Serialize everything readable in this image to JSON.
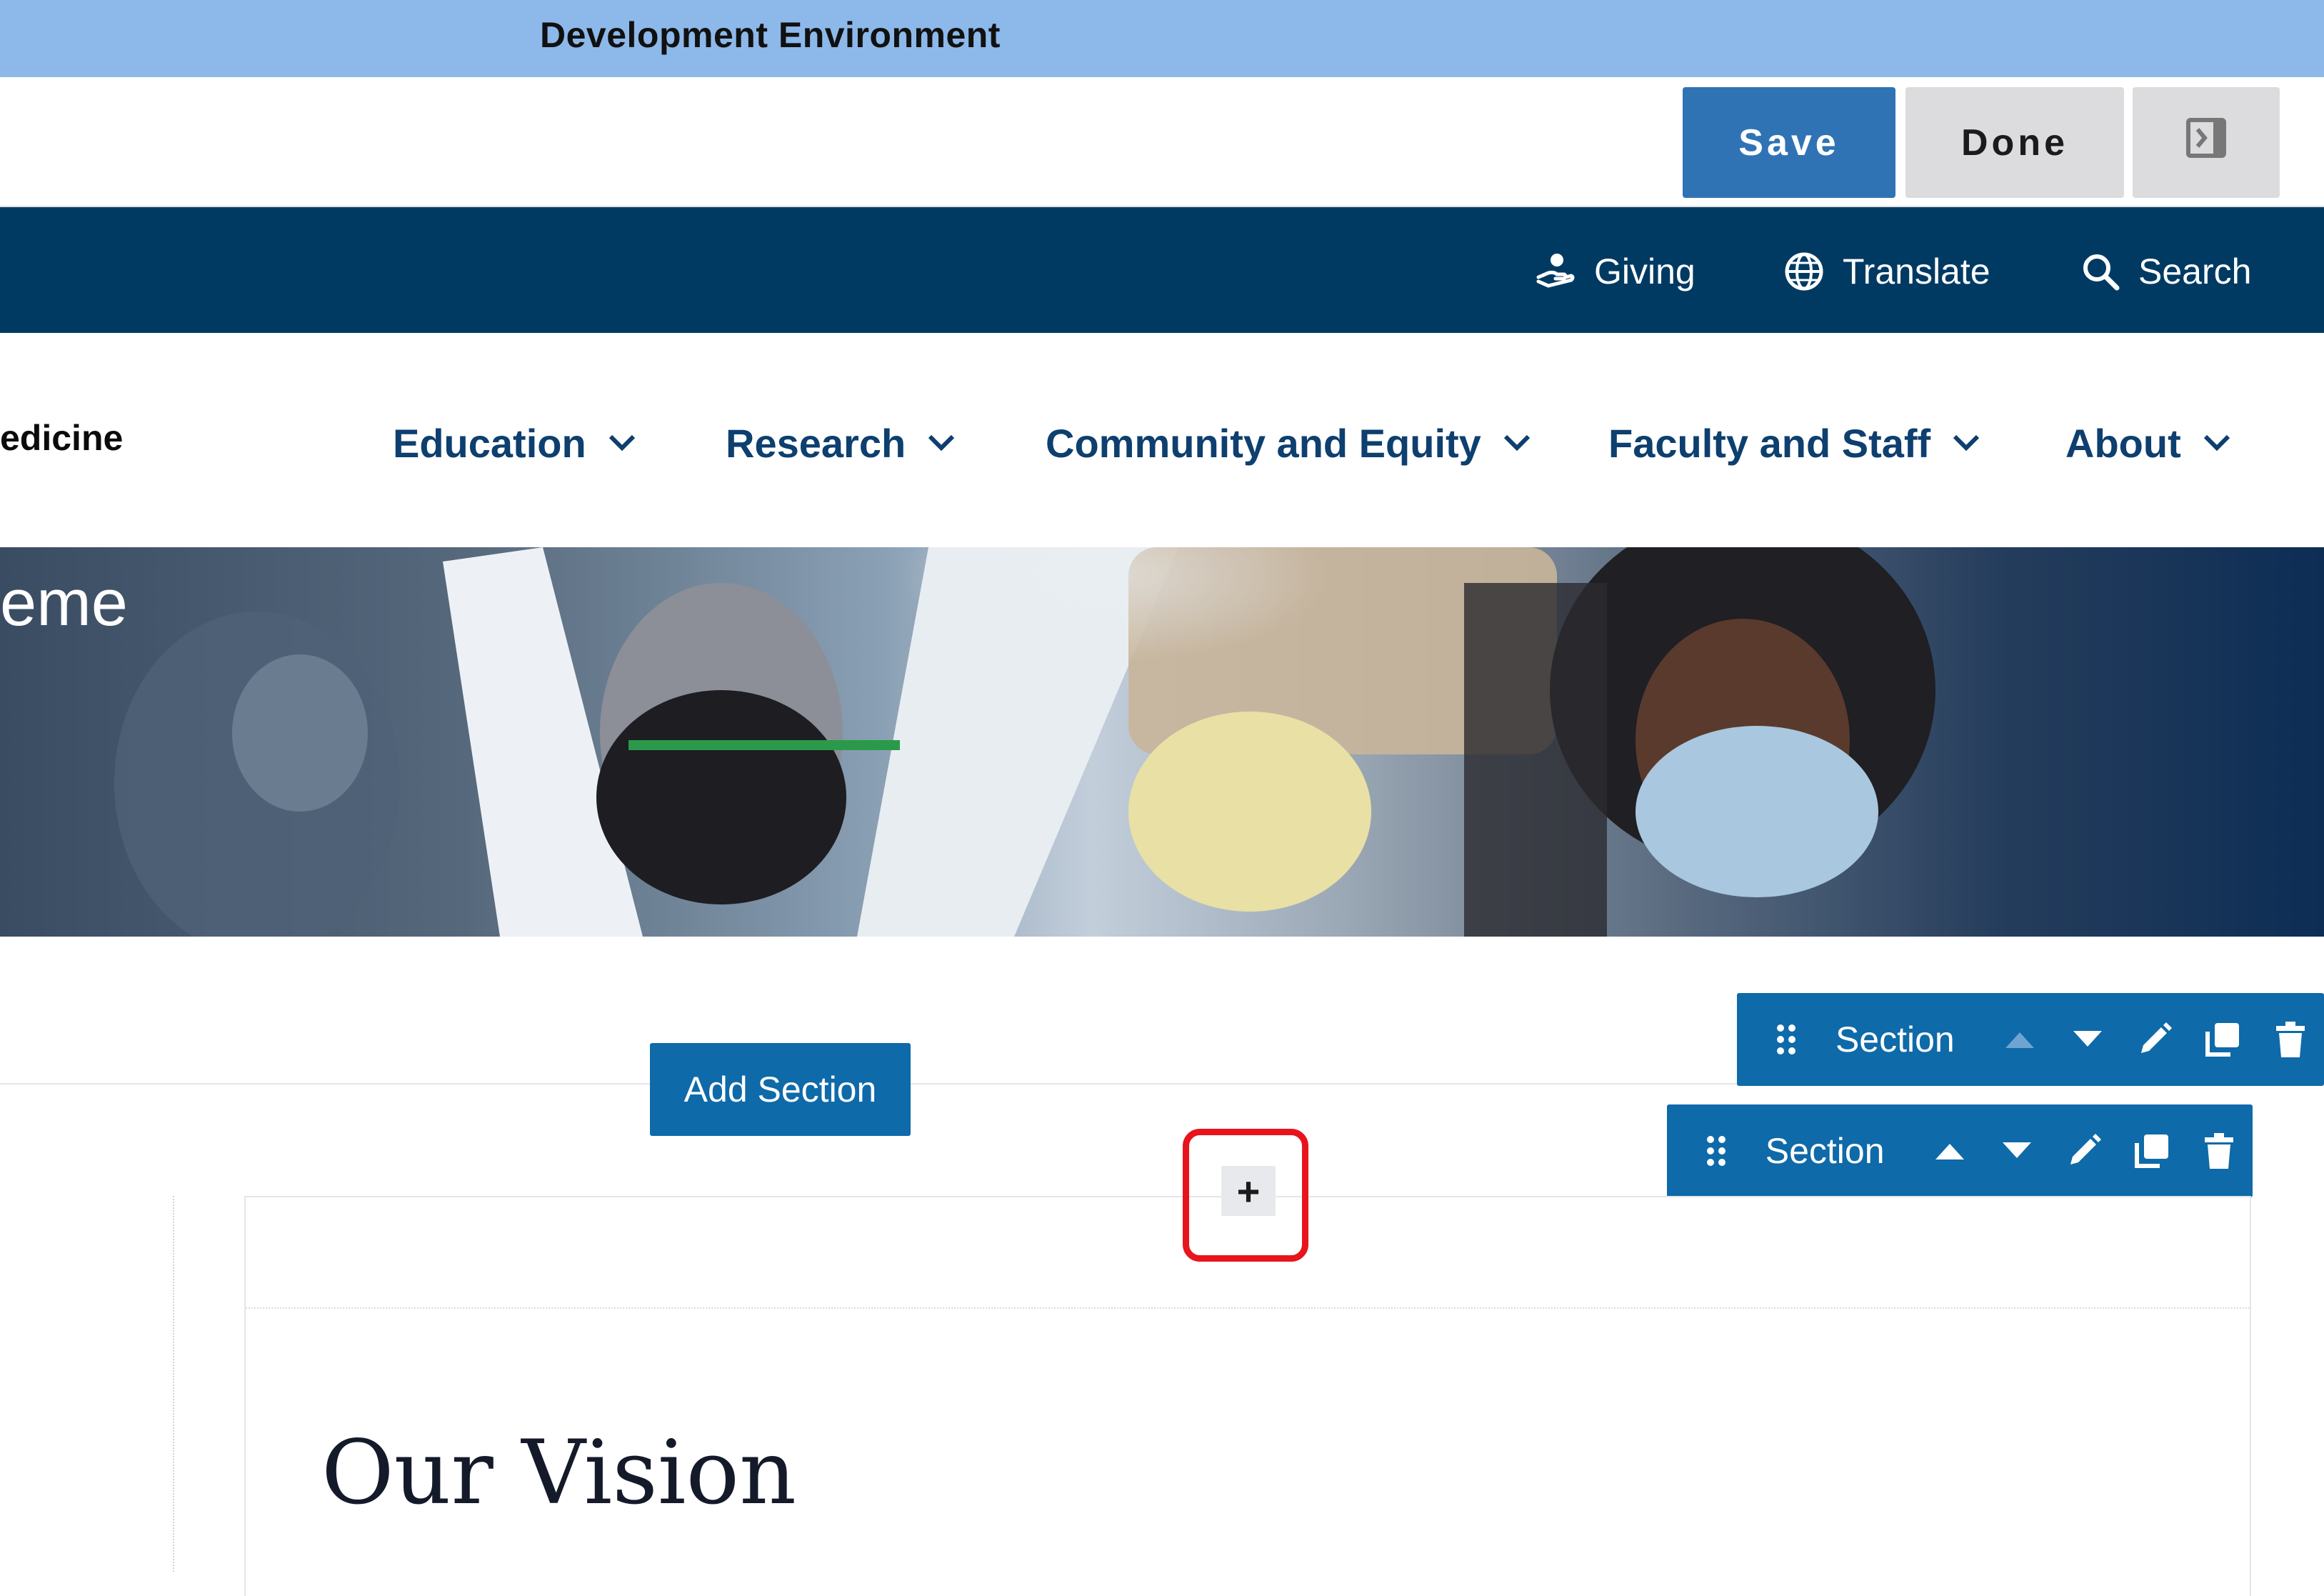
{
  "dev_banner": {
    "text": "Development Environment"
  },
  "toolbar": {
    "save_label": "Save",
    "done_label": "Done",
    "sidebar_toggle_icon": "sidebar-toggle-icon"
  },
  "utility_nav": {
    "items": [
      {
        "label": "Giving",
        "icon": "hand-giving-icon"
      },
      {
        "label": "Translate",
        "icon": "globe-icon"
      },
      {
        "label": "Search",
        "icon": "search-icon"
      }
    ]
  },
  "main_nav": {
    "site_name": "edicine",
    "items": [
      {
        "label": "Education"
      },
      {
        "label": "Research"
      },
      {
        "label": "Community and Equity"
      },
      {
        "label": "Faculty and Staff"
      },
      {
        "label": "About"
      }
    ]
  },
  "hero": {
    "title": "eme"
  },
  "layout_builder": {
    "add_section_label": "Add Section",
    "section_toolbars": [
      {
        "label": "Section",
        "move_up_enabled": false
      },
      {
        "label": "Section",
        "move_up_enabled": true
      }
    ],
    "add_block_label": "+"
  },
  "content": {
    "heading": "Our Vision"
  },
  "colors": {
    "banner": "#8db8ea",
    "primary_button": "#2f73b5",
    "utility_bar": "#003a63",
    "nav_text": "#0d3f6f",
    "section_toolbar": "#0e6aa9",
    "highlight": "#e8141c"
  }
}
